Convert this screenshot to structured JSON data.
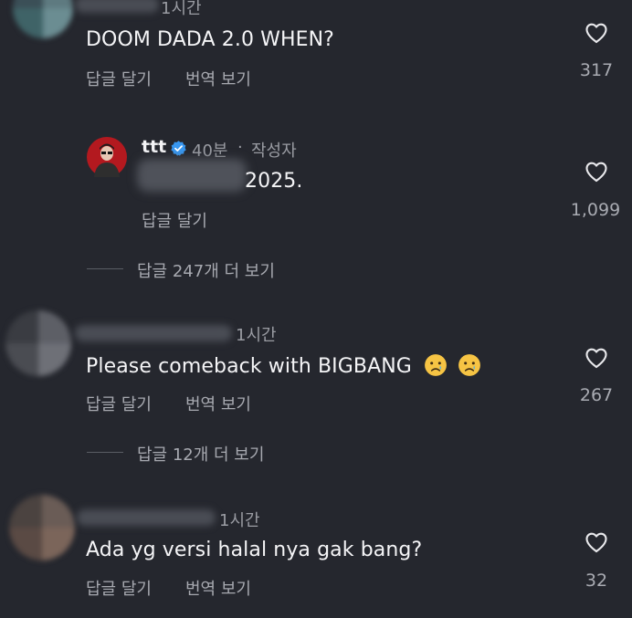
{
  "comments": [
    {
      "time": "1시간",
      "text": "DOOM DADA 2.0 WHEN?",
      "reply_label": "답글 달기",
      "translate_label": "번역 보기",
      "likes": "317"
    },
    {
      "username": "ttt",
      "verified_icon": "verified-badge-icon",
      "time": "40분",
      "separator": "·",
      "author_label": "작성자",
      "text": "2025.",
      "reply_label": "답글 달기",
      "likes": "1,099"
    },
    {
      "time": "1시간",
      "text": "Please comeback with BIGBANG",
      "emojis": [
        "crying-face-emoji",
        "crying-face-emoji"
      ],
      "reply_label": "답글 달기",
      "translate_label": "번역 보기",
      "likes": "267"
    },
    {
      "time": "1시간",
      "text": "Ada yg versi halal nya gak bang?",
      "reply_label": "답글 달기",
      "translate_label": "번역 보기",
      "likes": "32"
    }
  ],
  "view_replies": [
    {
      "label": "답글 247개 더 보기"
    },
    {
      "label": "답글 12개 더 보기"
    }
  ],
  "colors": {
    "background": "#25272e",
    "text": "#f5f5f7",
    "muted": "#a7a9b0",
    "verified": "#3897f0"
  }
}
